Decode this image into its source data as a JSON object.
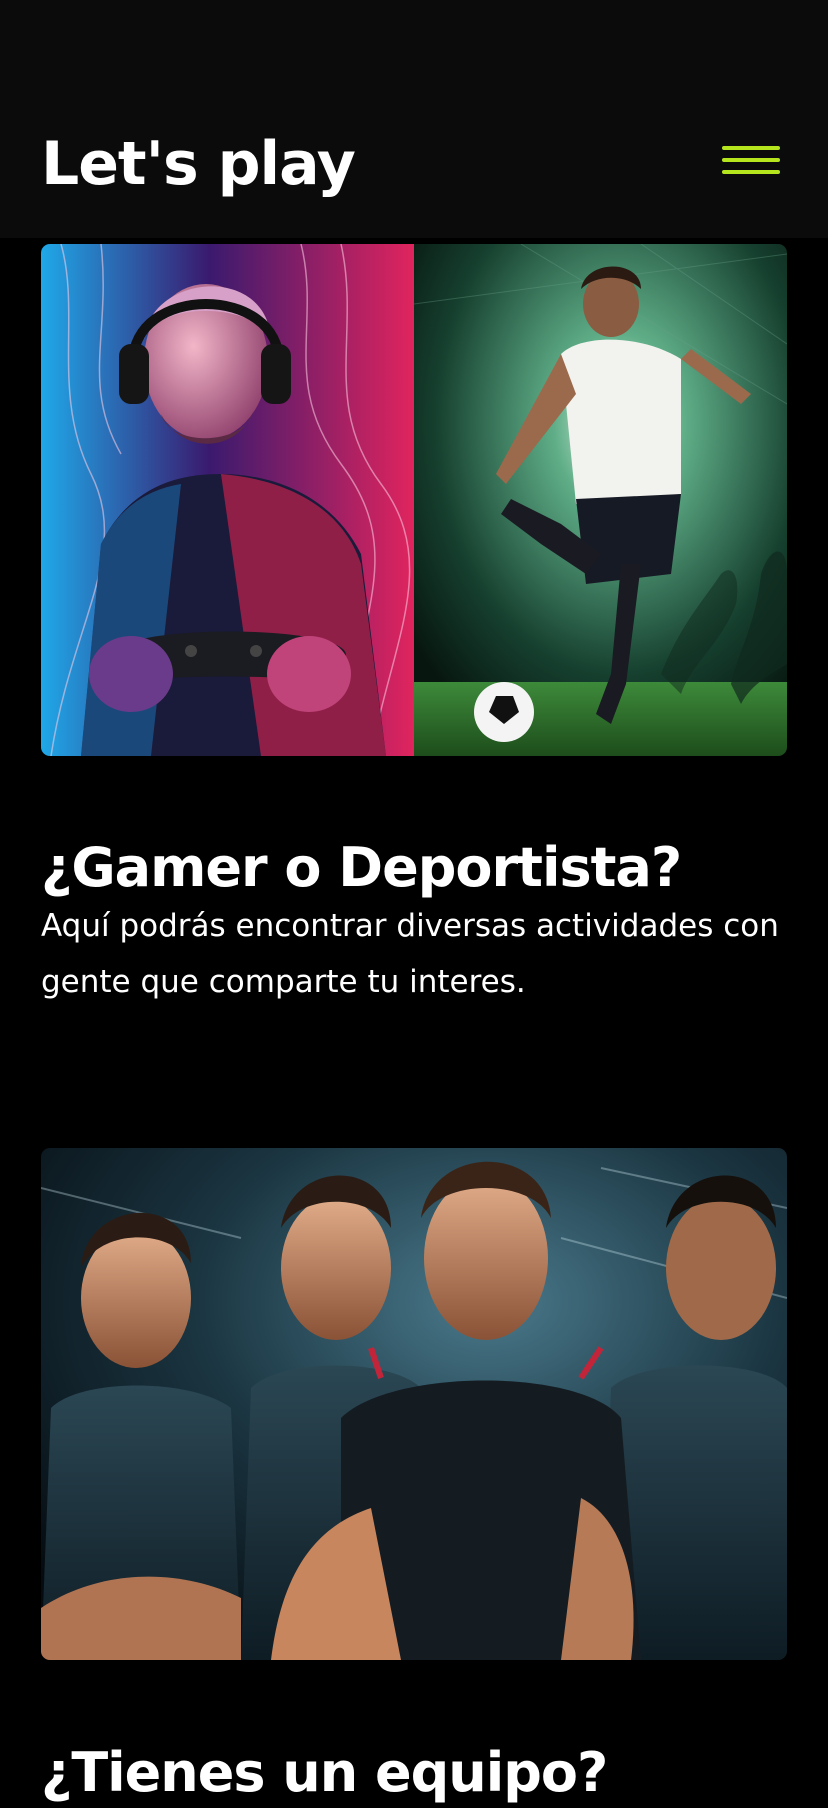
{
  "header": {
    "brand": "Let's play",
    "menu_icon": "hamburger-menu-icon",
    "accent_color": "#b5e61d",
    "background": "#0b0b0b"
  },
  "sections": [
    {
      "image_description_icon": "gamer-and-footballer-image",
      "title": "¿Gamer o Deportista?",
      "text": "Aquí podrás encontrar diversas actividades con gente que comparte tu interes."
    },
    {
      "image_description_icon": "team-players-image",
      "title": "¿Tienes un equipo?"
    }
  ],
  "colors": {
    "page_background": "#000000",
    "text": "#ffffff"
  }
}
